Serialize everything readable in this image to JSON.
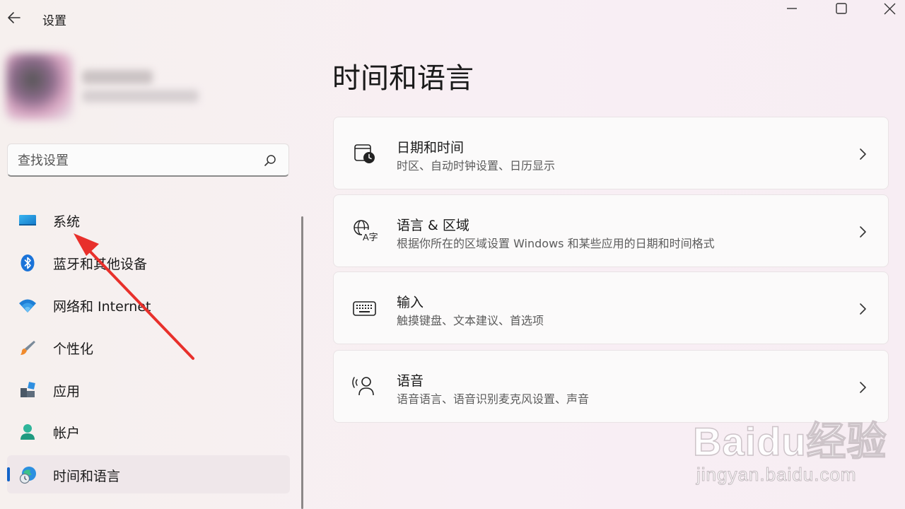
{
  "window": {
    "title": "设置",
    "controls": [
      "minimize-icon",
      "maximize-icon",
      "close-icon"
    ]
  },
  "search": {
    "placeholder": "查找设置",
    "icon": "search-icon"
  },
  "sidebar": {
    "items": [
      {
        "label": "系统",
        "icon": "monitor-icon",
        "selected": false
      },
      {
        "label": "蓝牙和其他设备",
        "icon": "bluetooth-icon",
        "selected": false
      },
      {
        "label": "网络和 Internet",
        "icon": "wifi-icon",
        "selected": false
      },
      {
        "label": "个性化",
        "icon": "brush-icon",
        "selected": false
      },
      {
        "label": "应用",
        "icon": "apps-icon",
        "selected": false
      },
      {
        "label": "帐户",
        "icon": "user-icon",
        "selected": false
      },
      {
        "label": "时间和语言",
        "icon": "globe-clock-icon",
        "selected": true
      }
    ]
  },
  "main": {
    "title": "时间和语言",
    "cards": [
      {
        "title": "日期和时间",
        "description": "时区、自动时钟设置、日历显示",
        "icon": "calendar-clock-icon"
      },
      {
        "title": "语言 & 区域",
        "description": "根据你所在的区域设置 Windows 和某些应用的日期和时间格式",
        "icon": "language-icon"
      },
      {
        "title": "输入",
        "description": "触摸键盘、文本建议、首选项",
        "icon": "keyboard-icon"
      },
      {
        "title": "语音",
        "description": "语音语言、语音识别麦克风设置、声音",
        "icon": "speech-icon"
      }
    ]
  },
  "watermark": {
    "logo": "Baidu经验",
    "url": "jingyan.baidu.com"
  },
  "colors": {
    "accent": "#1364c8",
    "annotation_arrow": "#e8302b"
  }
}
